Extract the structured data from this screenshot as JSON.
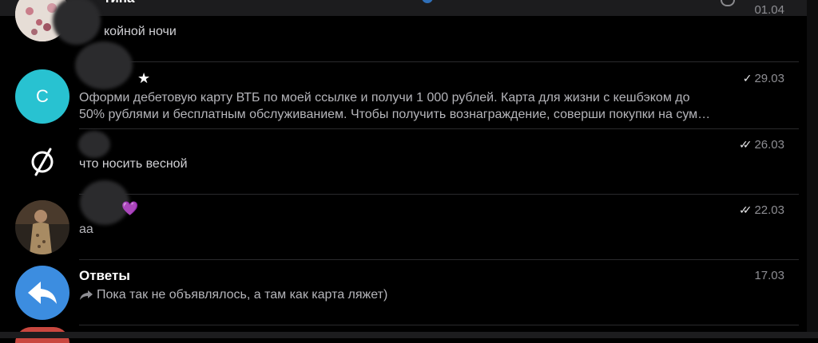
{
  "chats": [
    {
      "name": "тина",
      "preview": "койной ночи",
      "date": "01.04",
      "avatar_icon": "photo-avatar"
    },
    {
      "name": "",
      "starred": true,
      "avatar_initial": "С",
      "avatar_color": "#28c2d1",
      "date": "29.03",
      "read_status": "single-check",
      "preview_line1": "Оформи дебетовую карту ВТБ по моей ссылке и получи 1 000 рублей. Карта для жизни с кешбэком до",
      "preview_line2": "50% рублями и бесплатным обслуживанием. Чтобы получить вознаграждение, соверши покупки на сум…"
    },
    {
      "name": "",
      "avatar_icon": "ring-slash-logo",
      "date": "26.03",
      "read_status": "double-check",
      "preview": "что носить весной"
    },
    {
      "name": "",
      "emoji": "💜",
      "avatar_icon": "photo-avatar",
      "date": "22.03",
      "read_status": "double-check",
      "preview": "aa"
    },
    {
      "name": "Ответы",
      "avatar_icon": "reply-arrow",
      "avatar_color": "#3c8de0",
      "date": "17.03",
      "preview_icon": "forward-arrow",
      "preview": "Пока так не объявлялось, а там как карта ляжет)"
    }
  ]
}
